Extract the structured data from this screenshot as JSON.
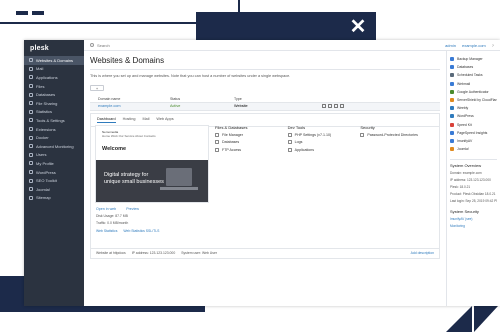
{
  "app": {
    "logo": "plesk",
    "topbar": {
      "search_placeholder": "Search",
      "user": "admin",
      "subscription": "example.com",
      "help": "?"
    },
    "page_title": "Websites & Domains",
    "description": "This is where you set up and manage websites. Note that you can host a number of websites under a single webspace."
  },
  "sidebar": {
    "items": [
      {
        "label": "Websites & Domains",
        "active": true
      },
      {
        "label": "Mail"
      },
      {
        "label": "Applications"
      },
      {
        "label": "Files"
      },
      {
        "label": "Databases"
      },
      {
        "label": "File Sharing"
      },
      {
        "label": "Statistics"
      },
      {
        "label": "Tools & Settings"
      },
      {
        "label": "Extensions"
      },
      {
        "label": "Docker"
      },
      {
        "label": "Advanced Monitoring"
      },
      {
        "label": "Users"
      },
      {
        "label": "My Profile"
      },
      {
        "label": "WordPress"
      },
      {
        "label": "SEO Toolkit"
      },
      {
        "label": "Joomla!"
      },
      {
        "label": "Sitemap"
      }
    ]
  },
  "table": {
    "headers": [
      "Domain name",
      "Status",
      "Type"
    ],
    "row": {
      "domain": "example.com",
      "status": "Active",
      "type": "Website"
    }
  },
  "panel": {
    "tabs": [
      "Dashboard",
      "Hosting",
      "Mail",
      "Web Apps"
    ],
    "preview": {
      "brand": "Nemomedia",
      "menu": "Home  Work  Our Service  About  Contacts",
      "heading": "Welcome",
      "hero_line1": "Digital strategy for",
      "hero_line2": "unique small businesses"
    },
    "open_in_web": "Open in web",
    "preview_link": "Preview",
    "disk_usage": "Disk Usage: 87.7 MB",
    "traffic": "Traffic: 0.0 MB/month",
    "web_statistics": "Web Statistics",
    "web_statistics_ssl": "Web Statistics SSL/TLS",
    "columns": [
      {
        "title": "Files & Databases",
        "items": [
          "File Manager",
          "Databases",
          "FTP Access"
        ]
      },
      {
        "title": "Dev Tools",
        "items": [
          "PHP Settings (v7.1.10)",
          "Logs",
          "Applications"
        ]
      },
      {
        "title": "Security",
        "items": [
          "Password-Protected Directories"
        ]
      }
    ],
    "footer": {
      "website_at": "Website at httpdocs",
      "ip": "IP address: 123.123.123.000",
      "system_user": "System user: Web User",
      "add_description": "Add description"
    }
  },
  "right_panel": {
    "items": [
      {
        "label": "Backup Manager",
        "color": "#3a7bd5"
      },
      {
        "label": "Databases",
        "color": "#3a7bd5"
      },
      {
        "label": "Scheduled Tasks",
        "color": "#5a6a7a"
      },
      {
        "label": "Webmail",
        "color": "#3a7bd5"
      },
      {
        "label": "Google Authenticator",
        "color": "#4a8b2c"
      },
      {
        "label": "ServerShield by CloudFlare",
        "color": "#e08a1e"
      },
      {
        "label": "Weebly",
        "color": "#2f7bbd"
      },
      {
        "label": "WordPress",
        "color": "#2f7bbd"
      },
      {
        "label": "Speed Kit",
        "color": "#d9423a"
      },
      {
        "label": "PageSpeed Insights",
        "color": "#3a7bd5"
      },
      {
        "label": "ImunifyAV",
        "color": "#3a7bd5"
      },
      {
        "label": "Joomla!",
        "color": "#e08a1e"
      }
    ],
    "system_overview": {
      "title": "System Overview",
      "domain": "Domain: example.com",
      "ip": "IP address: 123.123.123.000",
      "plesk": "Plesk: 18.0.21",
      "product": "Product: Plesk Obsidian 18.0.21",
      "last_login": "Last login: Sep 25, 2019 09:42 PM"
    },
    "system_security": {
      "title": "System Security",
      "line1": "ImunifyAV (see)",
      "line2": "Monitoring"
    }
  }
}
